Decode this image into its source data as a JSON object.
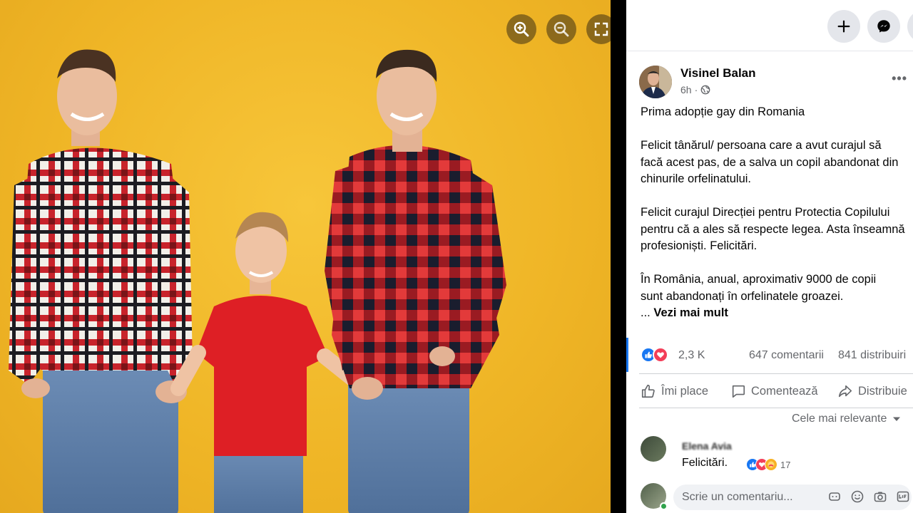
{
  "viewer": {
    "zoom_in_icon": "zoom-in-icon",
    "zoom_out_icon": "zoom-out-icon",
    "fullscreen_icon": "expand-icon"
  },
  "topbar": {
    "create_icon": "plus-icon",
    "messenger_icon": "messenger-icon"
  },
  "post": {
    "author": "Visinel Balan",
    "time": "6h",
    "time_separator": "·",
    "audience_icon": "globe-icon",
    "paragraphs": [
      [
        "Prima adopție gay din Romania"
      ],
      [
        "Felicit tânărul/ persoana care a avut curajul să",
        "facă acest pas, de a salva un copil abandonat din",
        "chinurile orfelinatului."
      ],
      [
        "Felicit curajul Direcției pentru Protectia Copilului",
        "pentru că a ales să respecte legea. Asta înseamnă",
        "profesioniști. Felicitări."
      ],
      [
        "În România, anual, aproximativ 9000 de copii",
        "sunt abandonați în orfelinatele groazei."
      ]
    ],
    "ellipsis": "...",
    "see_more": "Vezi mai mult",
    "reaction_count": "2,3 K",
    "comments_count": "647 comentarii",
    "shares_count": "841 distribuiri",
    "actions": {
      "like": "Îmi place",
      "comment": "Comentează",
      "share": "Distribuie"
    },
    "sort_label": "Cele mai relevante"
  },
  "comment": {
    "name": "Elena Avia",
    "text": "Felicitări.",
    "reaction_count": "17"
  },
  "composer": {
    "placeholder": "Scrie un comentariu..."
  },
  "colors": {
    "photo_bg": "#f0b92a",
    "like_blue": "#1877f2",
    "love_red": "#f33e58",
    "secondary_text": "#65676b"
  }
}
